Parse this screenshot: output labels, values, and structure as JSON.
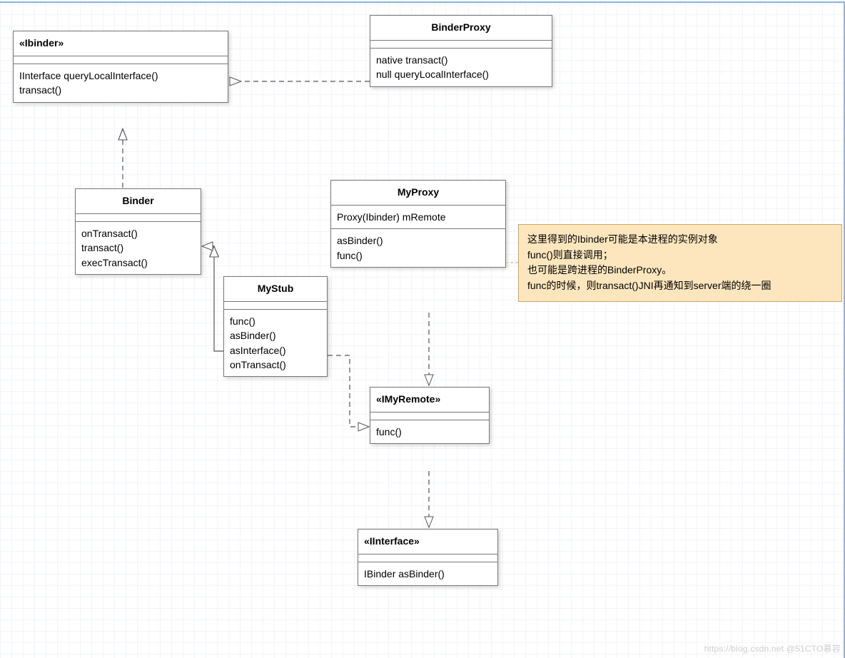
{
  "classes": {
    "ibinder": {
      "title": "«Ibinder»",
      "ops": [
        "IInterface queryLocalInterface()",
        "transact()"
      ]
    },
    "binderproxy": {
      "title": "BinderProxy",
      "ops": [
        "native transact()",
        "null queryLocalInterface()"
      ]
    },
    "binder": {
      "title": "Binder",
      "ops": [
        "onTransact()",
        "transact()",
        "execTransact()"
      ]
    },
    "myproxy": {
      "title": "MyProxy",
      "attrs": [
        "Proxy(Ibinder) mRemote"
      ],
      "ops": [
        "asBinder()",
        "func()"
      ]
    },
    "mystub": {
      "title": "MyStub",
      "ops": [
        "func()",
        "asBinder()",
        "asInterface()",
        "onTransact()"
      ]
    },
    "imyremote": {
      "title": "«IMyRemote»",
      "ops": [
        "func()"
      ]
    },
    "iinterface": {
      "title": "«IInterface»",
      "ops": [
        "IBinder asBinder()"
      ]
    }
  },
  "note": {
    "l1": "这里得到的Ibinder可能是本进程的实例对象",
    "l2": "func()则直接调用；",
    "l3": "也可能是跨进程的BinderProxy。",
    "l4": "func的时候，则transact()JNI再通知到server端的绕一圈"
  },
  "watermark": "https://blog.csdn.net @51CTO慕容"
}
